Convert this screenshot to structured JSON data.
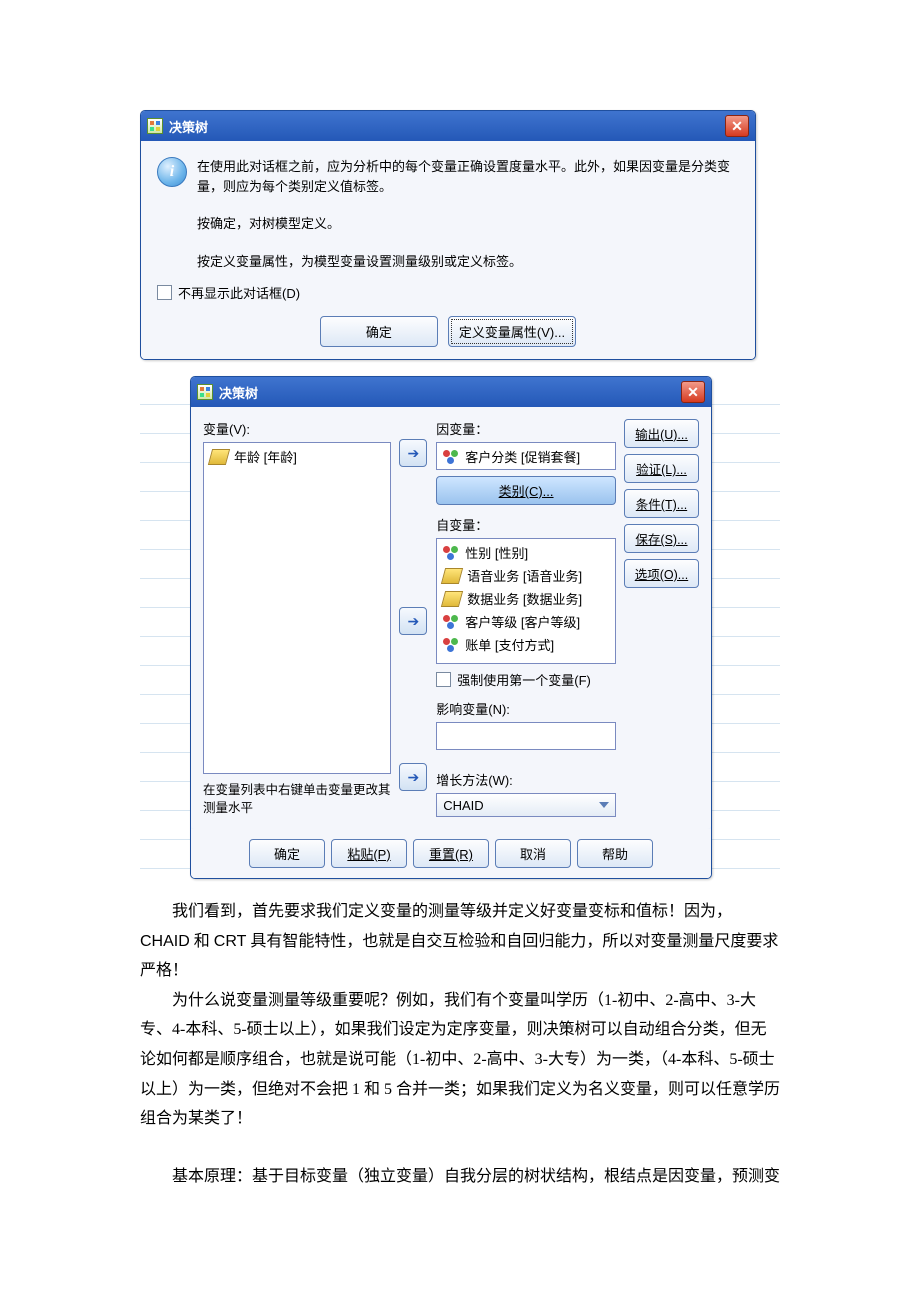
{
  "dialog1": {
    "title": "决策树",
    "info_p1": "在使用此对话框之前，应为分析中的每个变量正确设置度量水平。此外，如果因变量是分类变量，则应为每个类别定义值标签。",
    "info_p2": "按确定，对树模型定义。",
    "info_p3": "按定义变量属性，为模型变量设置测量级别或定义标签。",
    "dont_show": "不再显示此对话框(D)",
    "ok": "确定",
    "define": "定义变量属性(V)..."
  },
  "dialog2": {
    "title": "决策树",
    "vars_lbl": "变量(V):",
    "var_items": [
      "年龄 [年龄]"
    ],
    "dep_lbl": "因变量：",
    "dep_item": "客户分类 [促销套餐]",
    "cat_btn": "类别(C)...",
    "ind_lbl": "自变量：",
    "ind_items": [
      {
        "icon": "beads",
        "text": "性别 [性别]"
      },
      {
        "icon": "ruler",
        "text": "语音业务 [语音业务]"
      },
      {
        "icon": "ruler",
        "text": "数据业务 [数据业务]"
      },
      {
        "icon": "beads",
        "text": "客户等级 [客户等级]"
      },
      {
        "icon": "beads",
        "text": "账单 [支付方式]"
      }
    ],
    "force_first": "强制使用第一个变量(F)",
    "influence_lbl": "影响变量(N):",
    "growth_lbl": "增长方法(W):",
    "growth_value": "CHAID",
    "hint": "在变量列表中右键单击变量更改其测量水平",
    "side": {
      "output": "输出(U)...",
      "validate": "验证(L)...",
      "criteria": "条件(T)...",
      "save": "保存(S)...",
      "options": "选项(O)..."
    },
    "buttons": {
      "ok": "确定",
      "paste": "粘贴(P)",
      "reset": "重置(R)",
      "cancel": "取消",
      "help": "帮助"
    }
  },
  "text": {
    "p1_a": "我们看到，首先要求我们定义变量的测量等级并定义好变量变标和值标！因为，",
    "p1_b": "CHAID",
    "p1_c": " 和 ",
    "p1_d": "CRT",
    "p1_e": " 具有智能特性，也就是自交互检验和自回归能力，所以对变量测量尺度要求严格！",
    "p2": "为什么说变量测量等级重要呢？例如，我们有个变量叫学历（1-初中、2-高中、3-大专、4-本科、5-硕士以上），如果我们设定为定序变量，则决策树可以自动组合分类，但无论如何都是顺序组合，也就是说可能（1-初中、2-高中、3-大专）为一类，（4-本科、5-硕士以上）为一类，但绝对不会把 1 和 5 合并一类；如果我们定义为名义变量，则可以任意学历组合为某类了！",
    "p3": "基本原理：基于目标变量（独立变量）自我分层的树状结构，根结点是因变量，预测变"
  }
}
